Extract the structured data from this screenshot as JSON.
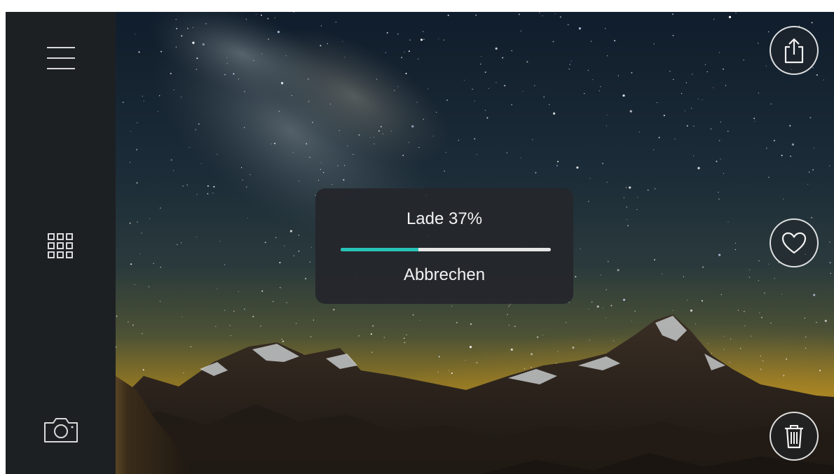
{
  "sidebar": {
    "items": [
      {
        "icon": "menu-icon"
      },
      {
        "icon": "grid-icon"
      },
      {
        "icon": "camera-icon"
      }
    ]
  },
  "actions": {
    "share": {
      "icon": "share-icon"
    },
    "favorite": {
      "icon": "heart-icon"
    },
    "delete": {
      "icon": "trash-icon"
    }
  },
  "loading_dialog": {
    "title": "Lade 37%",
    "progress": 0.37,
    "cancel_label": "Abbrechen"
  },
  "colors": {
    "sidebar_bg": "#1d2023",
    "dialog_bg": "#24262c",
    "progress_fill": "#27c3b6",
    "progress_track": "#e6e6e6"
  }
}
